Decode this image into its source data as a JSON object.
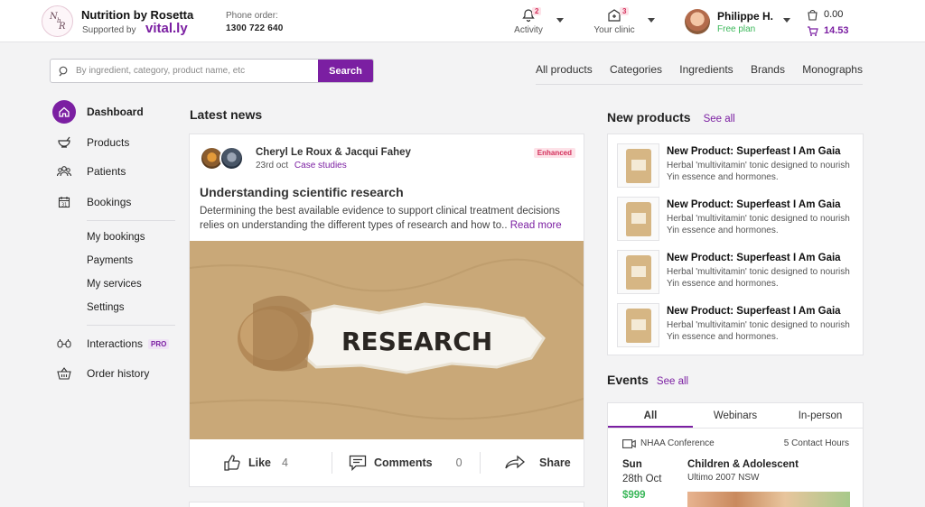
{
  "header": {
    "logo_letters": [
      "N",
      "b",
      "R"
    ],
    "brand": "Nutrition by Rosetta",
    "supported_by": "Supported by",
    "partner": "vital.ly",
    "phone_label": "Phone order:",
    "phone_number": "1300 722 640",
    "activity": {
      "label": "Activity",
      "count": "2"
    },
    "clinic": {
      "label": "Your clinic",
      "count": "3"
    },
    "user": {
      "name": "Philippe H.",
      "plan": "Free plan"
    },
    "cart": {
      "saved": "0.00",
      "total": "14.53"
    }
  },
  "search": {
    "placeholder": "By ingredient, category, product name, etc",
    "button": "Search"
  },
  "topnav": [
    "All products",
    "Categories",
    "Ingredients",
    "Brands",
    "Monographs"
  ],
  "sidebar": {
    "main": [
      {
        "label": "Dashboard",
        "icon": "home-icon"
      },
      {
        "label": "Products",
        "icon": "mortar-icon"
      },
      {
        "label": "Patients",
        "icon": "patients-icon"
      },
      {
        "label": "Bookings",
        "icon": "calendar-icon"
      }
    ],
    "sub": [
      "My bookings",
      "Payments",
      "My services",
      "Settings"
    ],
    "extra": [
      {
        "label": "Interactions",
        "badge": "PRO",
        "icon": "interactions-icon"
      },
      {
        "label": "Order history",
        "icon": "basket-icon"
      }
    ]
  },
  "news": {
    "section_title": "Latest news",
    "authors": "Cheryl Le Roux & Jacqui Fahey",
    "date": "23rd oct",
    "category": "Case studies",
    "badge": "Enhanced",
    "headline": "Understanding scientific research",
    "body": "Determining the best available evidence to support clinical treatment decisions relies on understanding the different types of research and how to..",
    "read_more": "Read more",
    "image_word": "RESEARCH",
    "actions": {
      "like": "Like",
      "like_count": "4",
      "comments": "Comments",
      "comments_count": "0",
      "share": "Share"
    }
  },
  "products": {
    "section_title": "New products",
    "see_all": "See all",
    "items": [
      {
        "title": "New Product: Superfeast I Am Gaia",
        "desc": "Herbal 'multivitamin' tonic designed to nourish Yin essence and hormones."
      },
      {
        "title": "New Product: Superfeast I Am Gaia",
        "desc": "Herbal 'multivitamin' tonic designed to nourish Yin essence and hormones."
      },
      {
        "title": "New Product: Superfeast I Am Gaia",
        "desc": "Herbal 'multivitamin' tonic designed to nourish Yin essence and hormones."
      },
      {
        "title": "New Product: Superfeast I Am Gaia",
        "desc": "Herbal 'multivitamin' tonic designed to nourish Yin essence and hormones."
      }
    ]
  },
  "events": {
    "section_title": "Events",
    "see_all": "See all",
    "tabs": [
      "All",
      "Webinars",
      "In-person"
    ],
    "item": {
      "type": "NHAA Conference",
      "hours": "5 Contact Hours",
      "day": "Sun",
      "date": "28th Oct",
      "price": "$999",
      "title": "Children & Adolescent",
      "location": "Ultimo 2007 NSW"
    }
  }
}
